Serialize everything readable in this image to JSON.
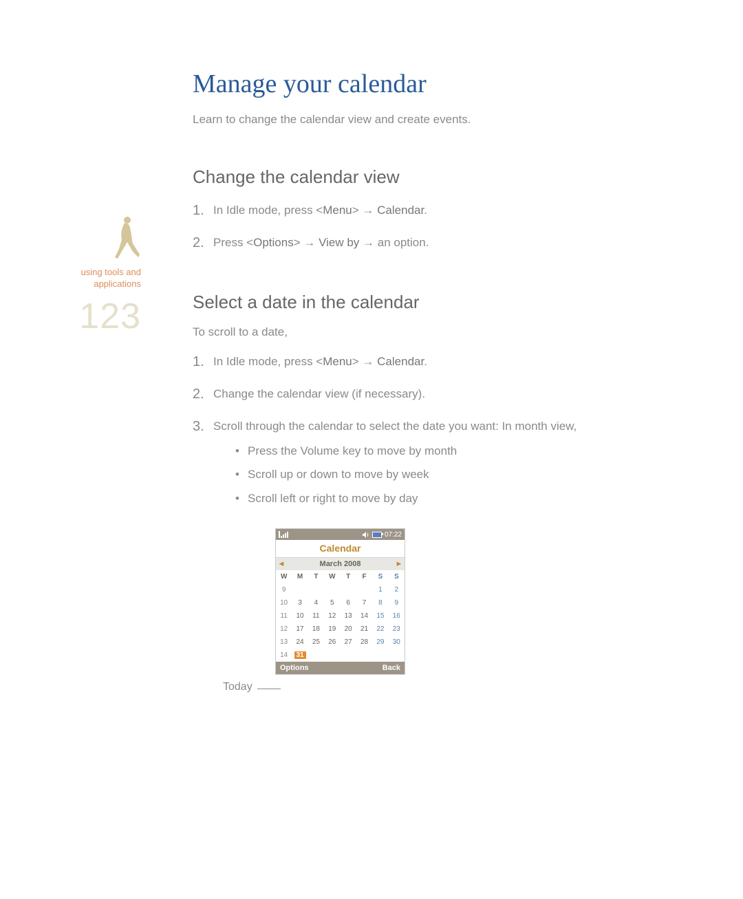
{
  "sidebar": {
    "label_line1": "using tools and",
    "label_line2": "applications",
    "page_number": "123"
  },
  "title": "Manage your calendar",
  "intro": "Learn to change the calendar view and create events.",
  "section1": {
    "heading": "Change the calendar view",
    "steps": [
      {
        "num": "1.",
        "pre": "In Idle mode, press <",
        "k1": "Menu",
        "mid": "> ",
        "arrow": "→",
        "post": " ",
        "k2": "Calendar",
        "end": "."
      },
      {
        "num": "2.",
        "pre": "Press <",
        "k1": "Options",
        "mid": "> ",
        "arrow": "→",
        "post": " ",
        "k2": "View by",
        "end": " → an option."
      }
    ]
  },
  "section2": {
    "heading": "Select a date in the calendar",
    "intro": "To scroll to a date,",
    "step1": {
      "num": "1.",
      "pre": "In Idle mode, press <",
      "k1": "Menu",
      "mid": "> ",
      "arrow": "→",
      "post": " ",
      "k2": "Calendar",
      "end": "."
    },
    "step2": {
      "num": "2.",
      "text": "Change the calendar view (if necessary)."
    },
    "step3": {
      "num": "3.",
      "lead": "Scroll through the calendar to select the date you want: In month view,",
      "bullets": [
        "Press the Volume key to move by month",
        "Scroll up or down to move by week",
        "Scroll left or right to move by day"
      ]
    }
  },
  "today_callout": "Today",
  "phone": {
    "time": "07:22",
    "app_title": "Calendar",
    "month_label": "March 2008",
    "month_prev": "◄",
    "month_next": "►",
    "day_headers": [
      "W",
      "M",
      "T",
      "W",
      "T",
      "F",
      "S",
      "S"
    ],
    "rows": [
      [
        "9",
        "",
        "",
        "",
        "",
        "",
        "1",
        "2"
      ],
      [
        "10",
        "3",
        "4",
        "5",
        "6",
        "7",
        "8",
        "9"
      ],
      [
        "11",
        "10",
        "11",
        "12",
        "13",
        "14",
        "15",
        "16"
      ],
      [
        "12",
        "17",
        "18",
        "19",
        "20",
        "21",
        "22",
        "23"
      ],
      [
        "13",
        "24",
        "25",
        "26",
        "27",
        "28",
        "29",
        "30"
      ],
      [
        "14",
        "31",
        "",
        "",
        "",
        "",
        "",
        ""
      ]
    ],
    "today_cell": "31",
    "softkey_left": "Options",
    "softkey_right": "Back"
  }
}
